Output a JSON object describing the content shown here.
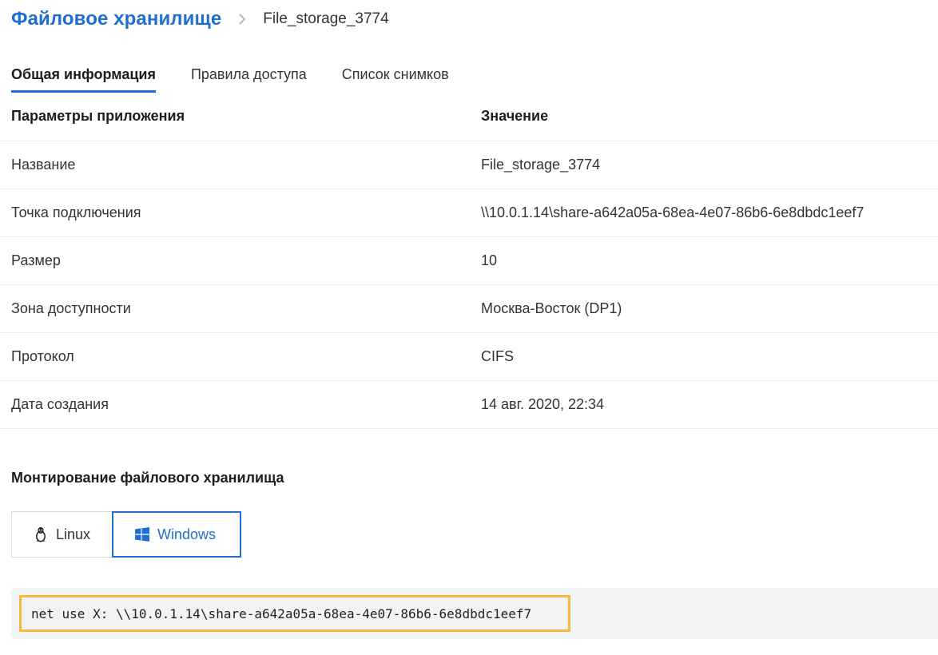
{
  "breadcrumb": {
    "root": "Файловое хранилище",
    "current": "File_storage_3774"
  },
  "tabs": [
    {
      "label": "Общая информация",
      "active": true
    },
    {
      "label": "Правила доступа",
      "active": false
    },
    {
      "label": "Список снимков",
      "active": false
    }
  ],
  "table": {
    "headers": [
      "Параметры приложения",
      "Значение"
    ],
    "rows": [
      {
        "label": "Название",
        "value": "File_storage_3774"
      },
      {
        "label": "Точка подключения",
        "value": "\\\\10.0.1.14\\share-a642a05a-68ea-4e07-86b6-6e8dbdc1eef7"
      },
      {
        "label": "Размер",
        "value": "10"
      },
      {
        "label": "Зона доступности",
        "value": "Москва-Восток (DP1)"
      },
      {
        "label": "Протокол",
        "value": "CIFS"
      },
      {
        "label": "Дата создания",
        "value": "14 авг. 2020, 22:34"
      }
    ]
  },
  "mount": {
    "title": "Монтирование файлового хранилища",
    "os_options": [
      {
        "label": "Linux",
        "icon": "linux-penguin-icon",
        "selected": false
      },
      {
        "label": "Windows",
        "icon": "windows-logo-icon",
        "selected": true
      }
    ],
    "command": "net use X: \\\\10.0.1.14\\share-a642a05a-68ea-4e07-86b6-6e8dbdc1eef7"
  },
  "colors": {
    "accent": "#1f6fd1",
    "highlight_border": "#f5b93d",
    "code_background": "#f2f3f5",
    "divider": "#ececec"
  }
}
